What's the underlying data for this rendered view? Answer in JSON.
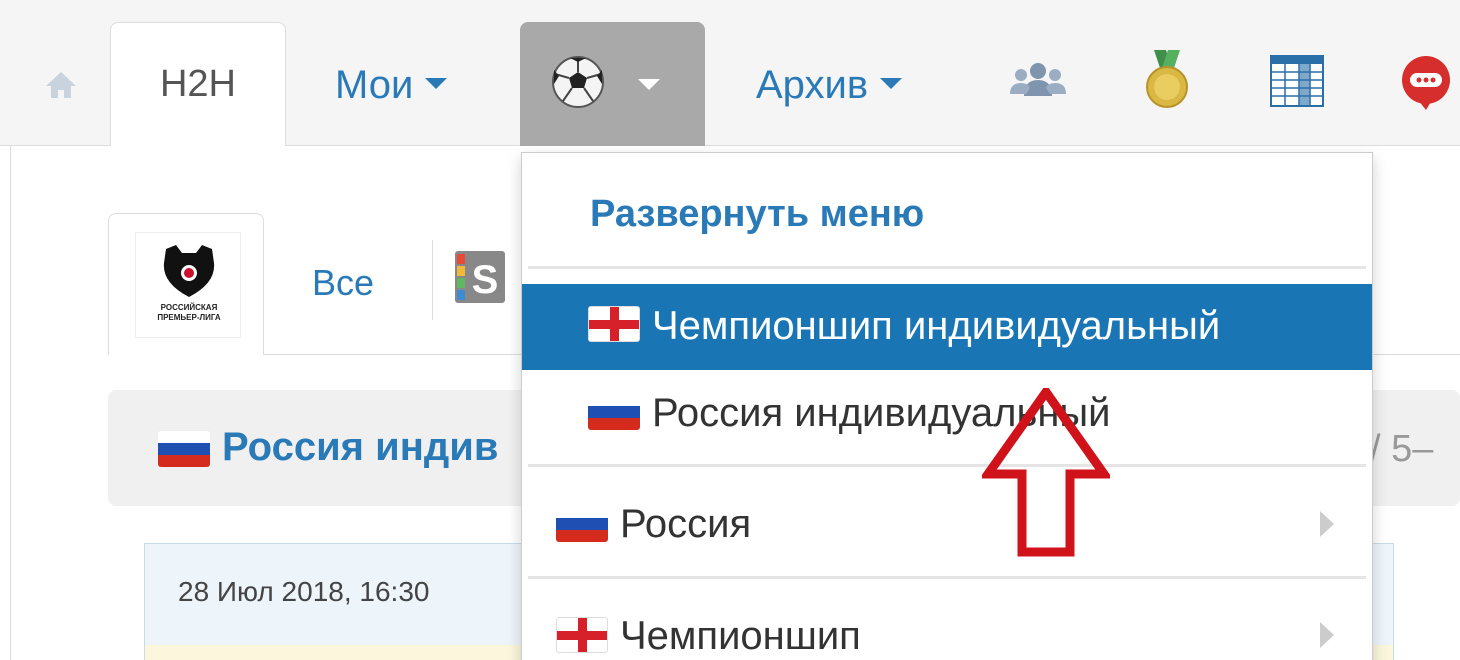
{
  "nav": {
    "h2h_label": "H2H",
    "my_label": "Мои",
    "archive_label": "Архив",
    "icons": [
      "home-icon",
      "soccer-ball-icon",
      "group-icon",
      "medal-icon",
      "table-icon",
      "chat-icon"
    ]
  },
  "subtabs": {
    "league_logo_text": "РОССИЙСКАЯ ПРЕМЬЕР-ЛИГА",
    "all_label": "Все"
  },
  "league": {
    "title": "Россия индив",
    "right_text": "/ 5–"
  },
  "match": {
    "date": "28 Июл 2018, 16:30"
  },
  "dropdown": {
    "expand_label": "Развернуть меню",
    "items": [
      {
        "label": "Чемпионшип индивидуальный",
        "flag": "england",
        "active": true
      },
      {
        "label": "Россия индивидуальный",
        "flag": "russia",
        "active": false
      },
      {
        "label": "Россия",
        "flag": "russia",
        "submenu": true
      },
      {
        "label": "Чемпионшип",
        "flag": "england",
        "submenu": true
      }
    ]
  },
  "colors": {
    "link_blue": "#2a7ab8",
    "active_blue": "#1a75b5",
    "annotation_red": "#d0121b"
  }
}
